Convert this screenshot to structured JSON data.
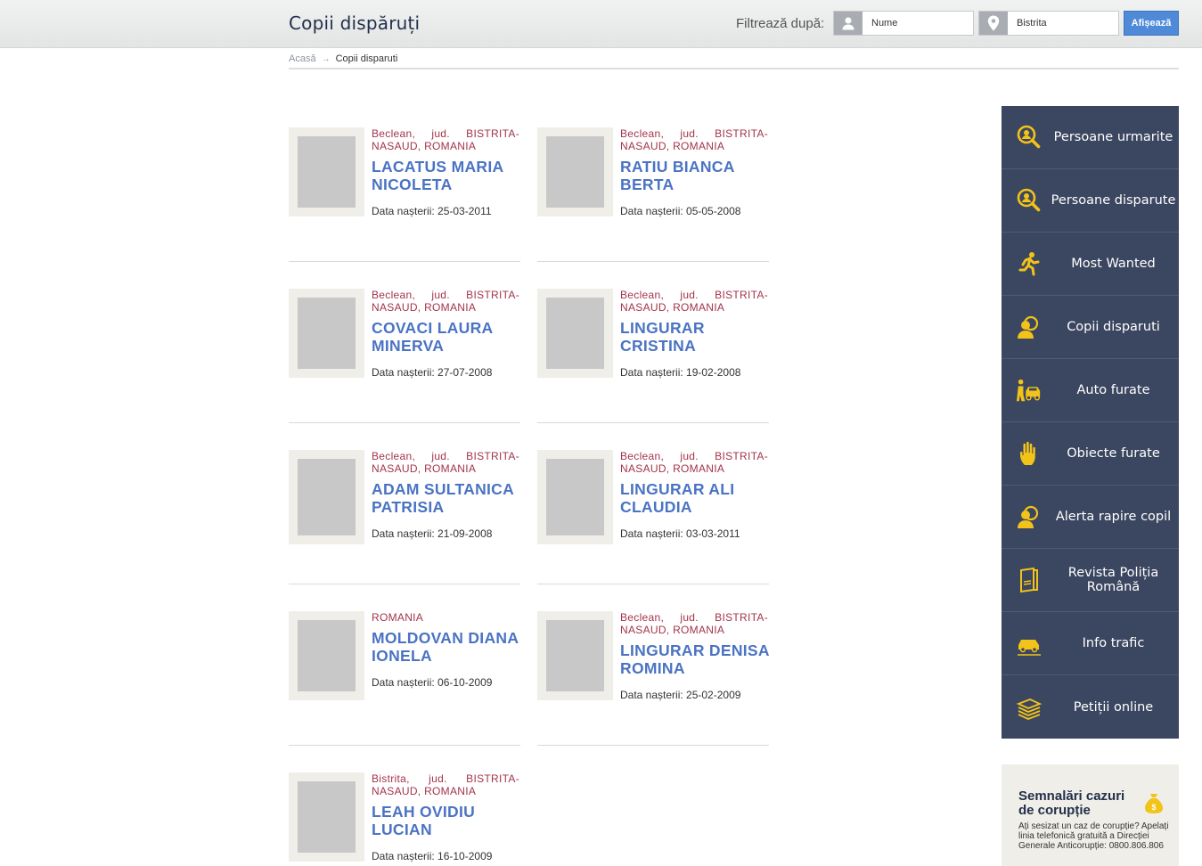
{
  "header": {
    "title": "Copii dispăruți",
    "filter_label": "Filtrează după:",
    "name_value": "Nume",
    "location_value": "Bistrita",
    "show_button": "Afișează"
  },
  "breadcrumb": {
    "home": "Acasă",
    "current": "Copii disparuti"
  },
  "children": [
    {
      "location": "Beclean, jud. BISTRITA-NASAUD, ROMANIA",
      "name": "LACATUS MARIA NICOLETA",
      "dob": "Data nașterii: 25-03-2011"
    },
    {
      "location": "Beclean, jud. BISTRITA-NASAUD, ROMANIA",
      "name": "RATIU BIANCA BERTA",
      "dob": "Data nașterii: 05-05-2008"
    },
    {
      "location": "Beclean, jud. BISTRITA-NASAUD, ROMANIA",
      "name": "COVACI LAURA MINERVA",
      "dob": "Data nașterii: 27-07-2008"
    },
    {
      "location": "Beclean, jud. BISTRITA-NASAUD, ROMANIA",
      "name": "LINGURAR CRISTINA",
      "dob": "Data nașterii: 19-02-2008"
    },
    {
      "location": "Beclean, jud. BISTRITA-NASAUD, ROMANIA",
      "name": "ADAM SULTANICA PATRISIA",
      "dob": "Data nașterii: 21-09-2008"
    },
    {
      "location": "Beclean, jud. BISTRITA-NASAUD, ROMANIA",
      "name": "LINGURAR ALI CLAUDIA",
      "dob": "Data nașterii: 03-03-2011"
    },
    {
      "location": "ROMANIA",
      "name": "MOLDOVAN DIANA IONELA",
      "dob": "Data nașterii: 06-10-2009"
    },
    {
      "location": "Beclean, jud. BISTRITA-NASAUD, ROMANIA",
      "name": "LINGURAR DENISA ROMINA",
      "dob": "Data nașterii: 25-02-2009"
    },
    {
      "location": "Bistrita, jud. BISTRITA-NASAUD, ROMANIA",
      "name": "LEAH OVIDIU LUCIAN",
      "dob": "Data nașterii: 16-10-2009"
    }
  ],
  "sidenav": [
    {
      "label": "Persoane urmarite",
      "icon": "search-person-icon"
    },
    {
      "label": "Persoane disparute",
      "icon": "search-person-icon"
    },
    {
      "label": "Most Wanted",
      "icon": "running-man-icon"
    },
    {
      "label": "Copii disparuti",
      "icon": "child-icon"
    },
    {
      "label": "Auto furate",
      "icon": "car-thief-icon"
    },
    {
      "label": "Obiecte furate",
      "icon": "hand-icon"
    },
    {
      "label": "Alerta rapire copil",
      "icon": "child-alert-icon"
    },
    {
      "label": "Revista Poliția Română",
      "icon": "magazine-icon"
    },
    {
      "label": "Info trafic",
      "icon": "traffic-car-icon"
    },
    {
      "label": "Petiții online",
      "icon": "documents-icon"
    }
  ],
  "corruption": {
    "title": "Semnalări cazuri de corupție",
    "text": "Ați sesizat un caz de corupție? Apelați linia telefonică gratuită a Direcției Generale Anticorupție: 0800.806.806",
    "icon": "money-bag-icon"
  },
  "colors": {
    "accent_blue": "#4a73c3",
    "location_red": "#a3344a",
    "nav_bg": "#3b4660",
    "icon_yellow": "#f2c318"
  }
}
